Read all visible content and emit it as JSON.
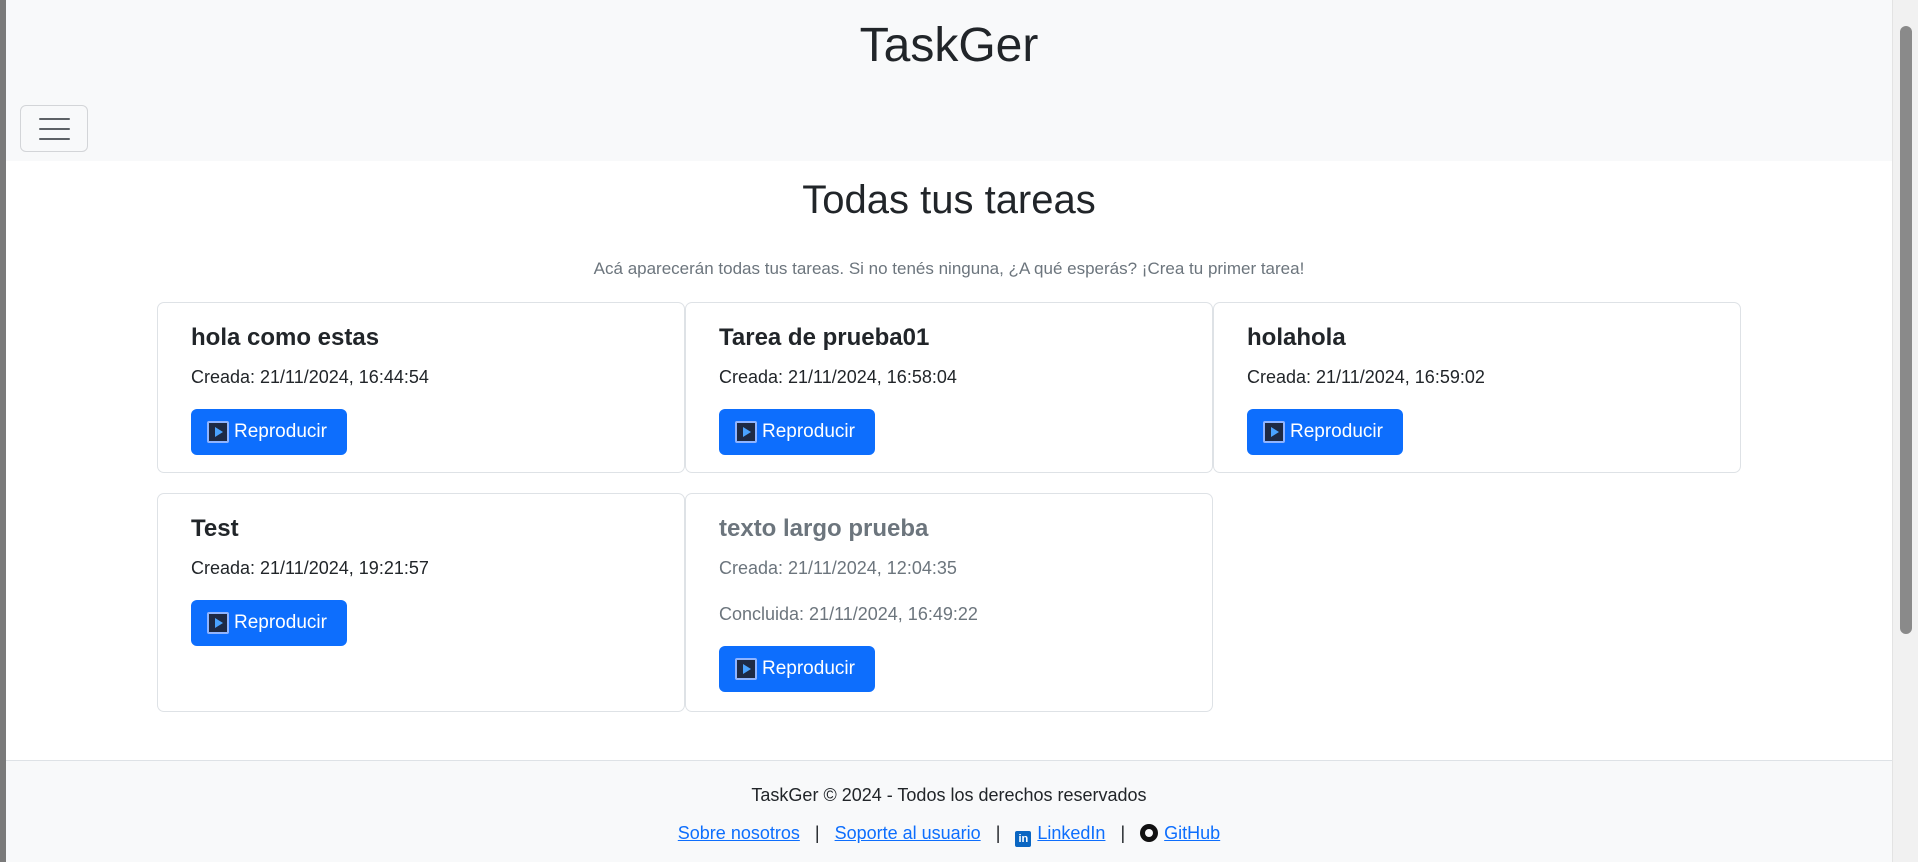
{
  "header": {
    "app_title": "TaskGer"
  },
  "main": {
    "title": "Todas tus tareas",
    "subtitle": "Acá aparecerán todas tus tareas. Si no tenés ninguna, ¿A qué esperás? ¡Crea tu primer tarea!",
    "play_label": "Reproducir",
    "tasks": [
      {
        "title": "hola como estas",
        "created": "Creada: 21/11/2024, 16:44:54",
        "completed": ""
      },
      {
        "title": "Tarea de prueba01",
        "created": "Creada: 21/11/2024, 16:58:04",
        "completed": ""
      },
      {
        "title": "holahola",
        "created": "Creada: 21/11/2024, 16:59:02",
        "completed": ""
      },
      {
        "title": "Test",
        "created": "Creada: 21/11/2024, 19:21:57",
        "completed": ""
      },
      {
        "title": "texto largo prueba",
        "created": "Creada: 21/11/2024, 12:04:35",
        "completed": "Concluida: 21/11/2024, 16:49:22"
      }
    ]
  },
  "footer": {
    "copyright": "TaskGer © 2024 - Todos los derechos reservados",
    "links": {
      "about": "Sobre nosotros",
      "support": "Soporte al usuario",
      "linkedin": "LinkedIn",
      "github": "GitHub"
    },
    "separator": "|"
  },
  "colors": {
    "primary": "#0d6efd",
    "muted": "#6c757d",
    "navbar_bg": "#f8f9fa"
  },
  "icons": {
    "menu": "hamburger-icon",
    "play": "play-icon",
    "linkedin": "linkedin-icon",
    "github": "github-icon"
  }
}
